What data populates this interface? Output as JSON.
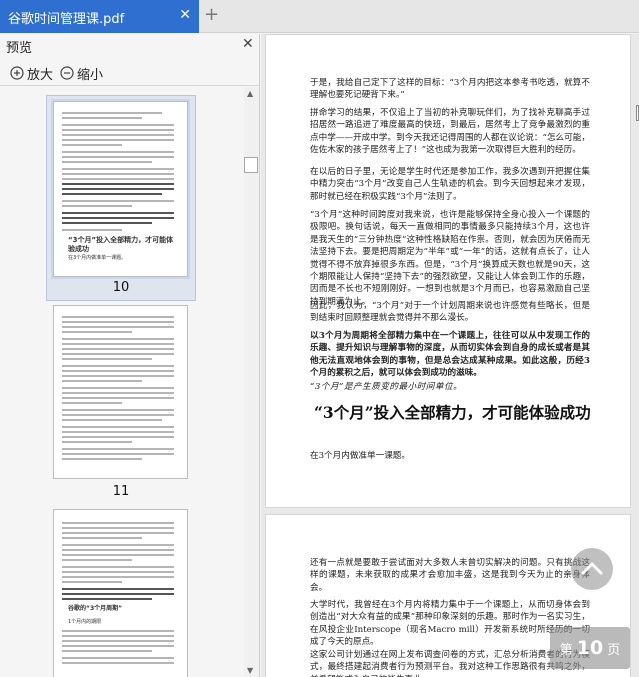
{
  "tab": {
    "title": "谷歌时间管理课.pdf",
    "close_icon": "close-icon",
    "new_tab_icon": "plus-icon"
  },
  "preview_panel": {
    "title": "预览",
    "zoom_in_label": "放大",
    "zoom_out_label": "缩小",
    "thumbnails": [
      {
        "page_label": "10",
        "heading": "“3个月”投入全部精力，才可能体验成功",
        "sub": "在3个月内做准单一课题。",
        "selected": true
      },
      {
        "page_label": "11",
        "selected": false
      },
      {
        "page_label": "",
        "heading": "谷歌的“3个月周期”",
        "sub": "1个月内的期限",
        "selected": false
      }
    ]
  },
  "document": {
    "page1_paragraphs": [
      {
        "text": "于是，我给自己定下了这样的目标：“3个月内把这本参考书吃透，就算不理解也要死记硬背下来。”",
        "style": "normal"
      },
      {
        "text": "拼命学习的结果，不仅追上了当初的补克聊玩伴们，为了找补克聊高手过招居然一路追进了难度最高的快班，到最后，居然考上了竞争最激烈的重点中学——开成中学。到今天我还记得周围的人都在议论说：“怎么可能，佐佐木家的孩子居然考上了！”这也成为我第一次取得巨大胜利的经历。",
        "style": "normal"
      },
      {
        "text": "在以后的日子里，无论是学生时代还是参加工作，我多次遇到开把握住集中精力突击“3个月”改变自己人生轨迹的机会。到今天回想起来才发现，那时就已经在积极实践“3个月”法则了。",
        "style": "normal"
      },
      {
        "text": "“3个月”这种时间跨度对我来说，也许是能够保持全身心投入一个课题的极限吧。换句话说，每天一直做相同的事情最多只能持续3个月，这也许是我天生的“三分钟热度”这种性格缺陷在作祟。否则，就会因为厌倦而无法坚持下去。要是把周期定为“半年”或“一年”的话，这就有点长了，让人觉得不得不放弃掉很多东西。但是，“3个月”换算成天数也就是90天，这个期限能让人保持“坚持下去”的强烈欲望，又能让人体会到工作的乐趣，因而是不长也不短刚刚好。一想到也就是3个月而已，也容易激励自己坚持到期满为止。",
        "style": "normal"
      },
      {
        "text": "因此，我认为，“3个月”对于一个计划周期来说也许感觉有些略长，但是到结束时回顾整理就会觉得并不那么漫长。",
        "style": "normal"
      },
      {
        "text": "以3个月为周期将全部精力集中在一个课题上，往往可以从中发现工作的乐趣、提升知识与理解事物的深度，从而切实体会到自身的成长或者是其他无法直观地体会到的事物，但是总会达成某种成果。如此这般，历经3个月的累积之后，就可以体会到成功的滋味。",
        "style": "bold"
      },
      {
        "text": "“3个月”是产生质变的最小时间单位。",
        "style": "italic"
      }
    ],
    "heading": "“3个月”投入全部精力，才可能体验成功",
    "subheading": "在3个月内做准单一课题。",
    "page2_paragraphs": [
      "还有一点就是要敢于尝试面对大多数人未曾切实解决的问题。只有挑战这样的课题，未来获取的成果才会愈加丰盛，这是我到今天为止的亲身体会。",
      "大学时代，我曾经在3个月内将精力集中于一个课题上，从而切身体会到创造出“对大众有益的成果”那种印象深刻的乐趣。那时作为一名实习生，在风投企业Interscope（现名Macro mill）开发新系统时所经历的一切成了今天的原点。",
      "这家公司计划通过在网上发布调查问卷的方式，汇总分析消费者的行为模式，最终搭建起消费者行为预测平台。我对这种工作思路很有共鸣之外，并希望能成为自己的毕生事业。"
    ]
  },
  "page_indicator": {
    "prefix": "第",
    "number": "10",
    "suffix": "页"
  }
}
